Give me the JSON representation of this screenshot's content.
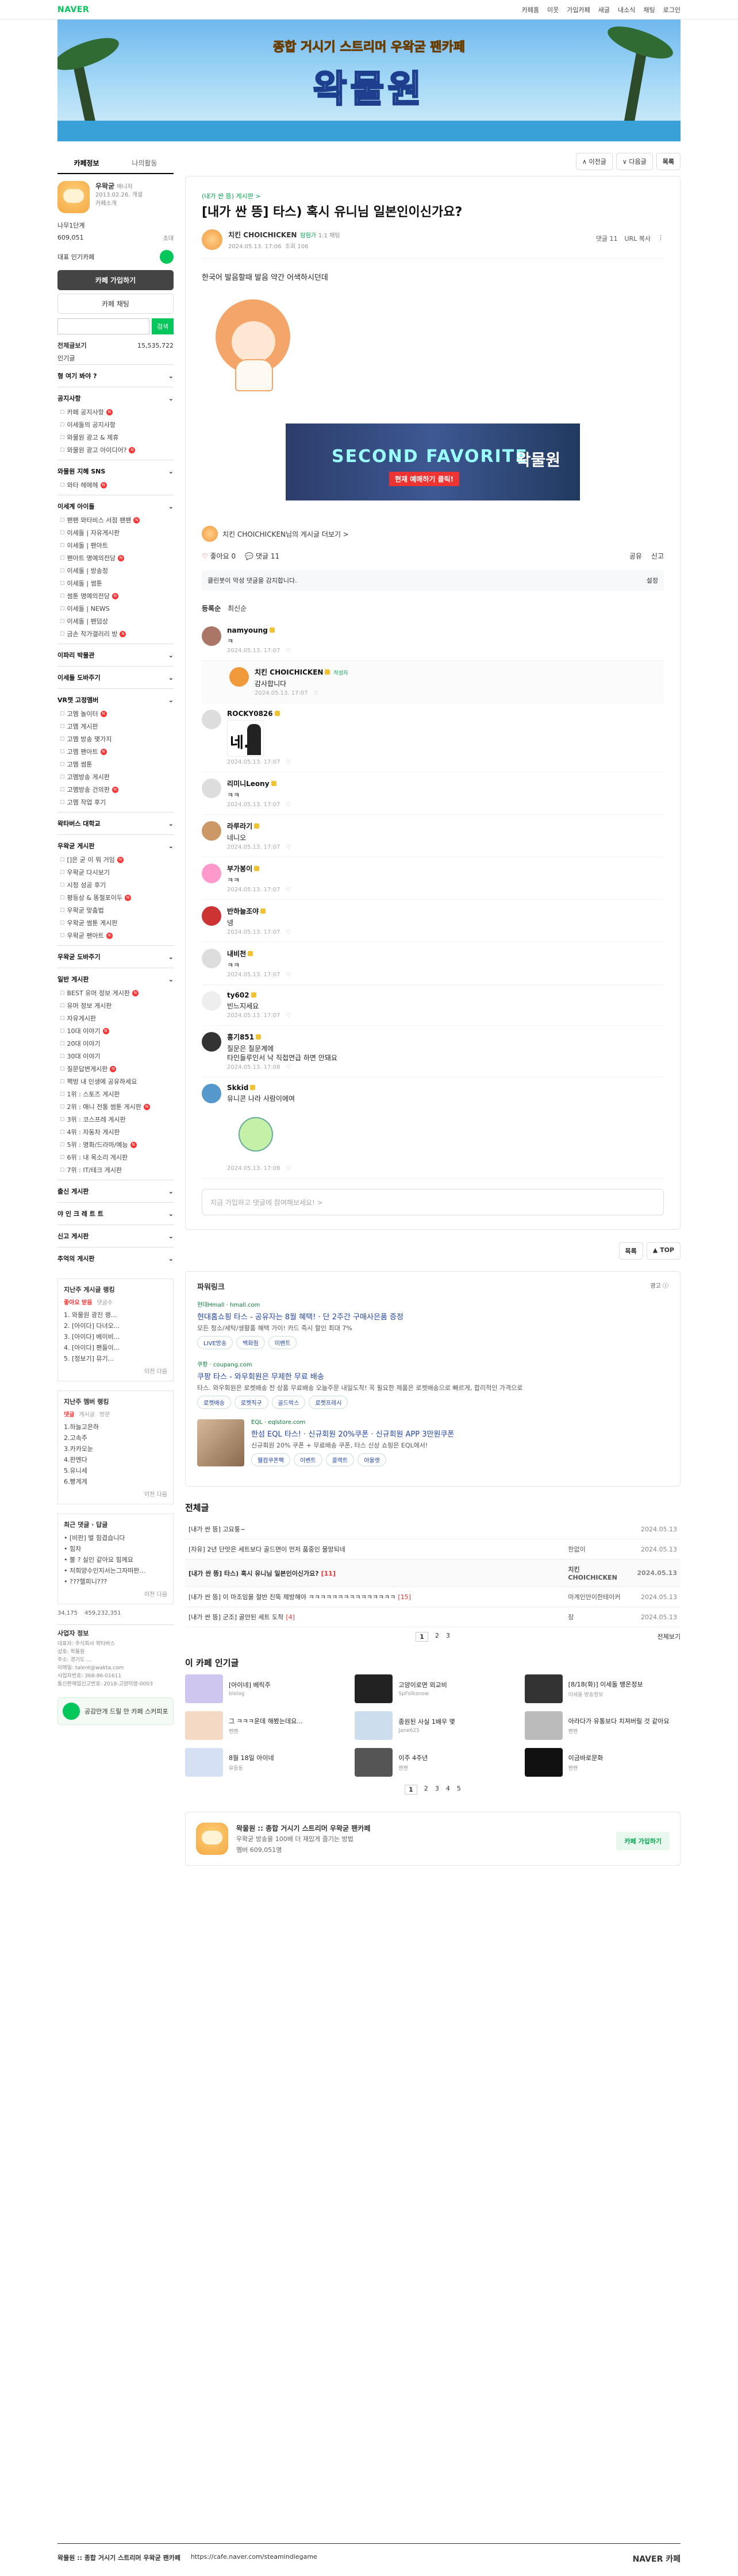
{
  "gnb": {
    "logo": "NAVER",
    "links": [
      "카페홈",
      "이웃",
      "가입카페",
      "새글",
      "내소식",
      "채팅",
      "로그인"
    ]
  },
  "banner": {
    "sub": "종합 거시기 스트리머 우왁굳 팬카페",
    "title": "왁물원"
  },
  "sidebar": {
    "tabs": [
      "카페정보",
      "나의활동"
    ],
    "manager": "우왁굳",
    "manager_role": "매니저",
    "since": "2013.02.26. 개설",
    "since_link": "카페소개",
    "level_name": "나무1단계",
    "members": "609,051",
    "members_link": "초대",
    "represent": "대표 인기카페",
    "join_btn": "카페 가입하기",
    "chat_btn": "카페 채팅",
    "search_btn": "검색",
    "all_posts": "전체글보기",
    "all_posts_count": "15,535,722",
    "popular": "인기글",
    "menus": [
      {
        "head": "형 여기 봐야 ?",
        "items": []
      },
      {
        "head": "공지사항",
        "items": [
          "카페 공지사항",
          "이세돌의 공지사항",
          "와물원 광고 & 제휴",
          "와물원 광고 아이디어?"
        ]
      },
      {
        "head": "와물원 지혜 SNS",
        "items": [
          "와타 헤에헤"
        ]
      },
      {
        "head": "이세계 아이돌",
        "items": [
          "팬팬 와타비스 서점 팬팬",
          "이세돌 | 자유게시판",
          "이세돌 | 팬아트",
          "팬아트 명예의전당",
          "이세돌 | 방송정",
          "이세돌 | 썸툰",
          "썸툰 명예의전당",
          "이세돌 | NEWS",
          "이세돌 | 팬덤상",
          "금손 작가갤러리 방"
        ]
      },
      {
        "head": "이파리 박물관",
        "items": []
      },
      {
        "head": "이세돌 도바주기",
        "items": []
      },
      {
        "head": "VR챗 고정멤버",
        "items": [
          "고멤 놀이터",
          "고멤 게시판",
          "고멤 방송 몇가지",
          "고멤 팬아트",
          "고멤 썸툰",
          "고멤방송 게시판",
          "고멤방송 건의판",
          "고멤 작업 후기"
        ]
      },
      {
        "head": "왁타버스 대학교",
        "items": []
      },
      {
        "head": "우왁굳 게시판",
        "items": [
          "[]은 굳 이 뭐 거임",
          "우왁굳 다시보기",
          "시청 성공 후기",
          "평등상 & 똥철포이두",
          "우왁굳 맞춤법",
          "우왁굳 썸툰 게시판",
          "우왁굳 팬아트"
        ]
      },
      {
        "head": "우왁굳 도바주기",
        "items": []
      },
      {
        "head": "일반 게시판",
        "items": [
          "BEST 유머 정보 게시판",
          "유머 정보 게시판",
          "자유게시판",
          "10대 이야기",
          "20대 이야기",
          "30대 이야기",
          "질문답변게시판",
          "팩방 내 인생에 공유하세요",
          "1위 : 스토즈 게시판",
          "2위 : 애니 전통 썸툰 게시판",
          "3위 : 코스프레 게시판",
          "4위 : 자동차 게시판",
          "5위 : 명화/드라마/예능",
          "6위 : 내 목소리 게시판",
          "7위 : IT/테크 게시판"
        ]
      },
      {
        "head": "출신 게시판",
        "items": []
      },
      {
        "head": "야 인 크 레 트 트",
        "items": []
      },
      {
        "head": "신고 게시판",
        "items": []
      },
      {
        "head": "추억의 게시판",
        "items": []
      }
    ],
    "rank1": {
      "title": "지난주 게시글 랭킹",
      "tabs": [
        "좋아요 받음",
        "댓글수"
      ],
      "items": [
        "1. 와물원 광진 랭...",
        "2. [아이다] 다녀오...",
        "3. [아이다] 베이비...",
        "4. [아이다] 팬들이...",
        "5. [정보기] 뮤기..."
      ],
      "pager": "이전 다음"
    },
    "rank2": {
      "title": "지난주 멤버 랭킹",
      "tabs": [
        "댓글",
        "게시글",
        "방문"
      ],
      "items": [
        "1.하늘고은하",
        "2.고속주",
        "3.카카오눈",
        "4.판멘다",
        "5.유니세",
        "6.빵게게"
      ],
      "pager": "이전 다음"
    },
    "rank3": {
      "title": "최근 댓글 · 답글",
      "items": [
        "• [비판] 벌 힘겹습니다",
        "• 힘차",
        "• 불 ? 실인 같아요 힘께요",
        "• 저희양수인지서는그자떠판...",
        "• ???헬피니???"
      ],
      "pager": "이전 다음"
    },
    "stats": [
      "34,175",
      "459,232,351"
    ],
    "biz": {
      "title": "사업자 정보",
      "lines": [
        "대표자: 주식회사 왁타버스",
        "상호: 왁물원",
        "주소: 경기도 ...",
        "이메일: talent@wakta.com",
        "사업자번호: 368-86-01611",
        "통신판매업신고번호: 2018-고양덕양-0003"
      ]
    },
    "green": "공감만개 드릴 만 카페 스커피포"
  },
  "topbar": {
    "prev": "∧ 이전글",
    "next": "∨ 다음글",
    "list": "목록"
  },
  "article": {
    "category": "(내가 싼 뜽) 게시판 >",
    "title": "[내가 싼 뜽] 타스) 혹시 유니님 일본인이신가요?",
    "author": "치킨 CHOICHICKEN",
    "author_role": "탐험가",
    "chat": "1:1 채팅",
    "date": "2024.05.13. 17:06",
    "views": "조회 106",
    "comments_label": "댓글 11",
    "url_copy": "URL 복사",
    "body": "한국어 발음할때 발음 약간 어색하시던데",
    "ad": {
      "left": "SECOND FAVORITE",
      "mid": "현재 예매하기 클릭!",
      "right": "왁물원"
    },
    "writer_link": "치킨 CHOICHICKEN님의 게시글 더보기 >",
    "likes": "좋아요 0",
    "comments": "댓글 11",
    "share": "공유",
    "report": "신고",
    "clean": "클린봇이 악성 댓글을 감지합니다.",
    "clean_setting": "설정",
    "ctabs": [
      "등록순",
      "최신순"
    ],
    "comment_items": [
      {
        "name": "namyoung",
        "text": "ㅋ",
        "date": "2024.05.13. 17:07",
        "reply": false,
        "color": "#a76"
      },
      {
        "name": "치킨 CHOICHICKEN",
        "text": "감사합니다",
        "date": "2024.05.13. 17:07",
        "reply": true,
        "color": "#f09a3c",
        "tag": "작성자"
      },
      {
        "name": "ROCKY0826",
        "text": "",
        "date": "2024.05.13. 17:07",
        "reply": false,
        "color": "#ddd",
        "img": "ne"
      },
      {
        "name": "리미니Leony",
        "text": "ㅋㅋ",
        "date": "2024.05.13. 17:07",
        "reply": false,
        "color": "#ddd"
      },
      {
        "name": "라루라기",
        "text": "네니오",
        "date": "2024.05.13. 17:07",
        "reply": false,
        "color": "#c96"
      },
      {
        "name": "부가봉이",
        "text": "ㅋㅋ",
        "date": "2024.05.13. 17:07",
        "reply": false,
        "color": "#f9c"
      },
      {
        "name": "반하늘조야",
        "text": "넹",
        "date": "2024.05.13. 17:07",
        "reply": false,
        "color": "#c33"
      },
      {
        "name": "내비천",
        "text": "ㅋㅋ",
        "date": "2024.05.13. 17:07",
        "reply": false,
        "color": "#ddd"
      },
      {
        "name": "ty602",
        "text": "빈느지세요",
        "date": "2024.05.13. 17:07",
        "reply": false,
        "color": "#eee"
      },
      {
        "name": "흥기851",
        "text": "질문은 질문계에\n타인들루인서 낙 직접연급 하면 안돼요",
        "date": "2024.05.13. 17:08",
        "reply": false,
        "color": "#333"
      },
      {
        "name": "Skkid",
        "text": "유니콘 나라 사람이에여",
        "date": "2024.05.13. 17:08",
        "reply": false,
        "color": "#59c",
        "img": "dino"
      }
    ],
    "comment_placeholder": "지금 가입하고 댓글에 참여해보세요! >"
  },
  "botbar": {
    "list": "목록",
    "top": "▲ TOP"
  },
  "powerlink": {
    "title": "파워링크",
    "ad": "광고 ⓘ",
    "ads": [
      {
        "src": "현대Hmall · hmall.com",
        "title": "현대홈쇼핑 타스 - 공유자는 8월 혜택! · 단 2주간 구매사은품 증정",
        "desc": "모든 청소/세탁/생활품 혜택 가이! 카드 즉시 할인 최대 7%",
        "chips": [
          "LIVE방송",
          "백화점",
          "이벤트"
        ]
      },
      {
        "src": "쿠팡 · coupang.com",
        "title": "쿠팡 타스 - 와우회원은 무제한 무료 배송",
        "desc": "타스. 와우회원은 로켓배송 전 상품 무료배송 오늘주문 내일도착! 꼭 필요한 제품은 로켓배송으로 빠르게, 합리적인 가격으로",
        "chips": [
          "로켓배송",
          "로켓직구",
          "골드박스",
          "로켓프레시"
        ]
      },
      {
        "src": "EQL · eqlstore.com",
        "title": "한섬 EQL 타스! · 신규회원 20%쿠폰 · 신규회원 APP 3만원쿠폰",
        "desc": "신규회원 20% 쿠폰 + 무료배송 쿠폰, 타스 신상 쇼핑은 EQL에서!",
        "chips": [
          "웰컴쿠폰팩",
          "이벤트",
          "콜렉트",
          "아울렛"
        ]
      }
    ]
  },
  "allposts": {
    "title": "전체글",
    "rows": [
      {
        "t": "[내가 싼 뜽] 고요퉁~",
        "c": "",
        "a": "",
        "d": "2024.05.13"
      },
      {
        "t": "[자유] 2년 단맛은 세트보다 골드면이 먼저 품중인 물망되네",
        "c": "",
        "a": "한없이",
        "d": "2024.05.13"
      },
      {
        "t": "[내가 싼 뜽] 타스) 혹시 유니님 일본인이신가요?",
        "c": "[11]",
        "a": "치킨 CHOICHICKEN",
        "d": "2024.05.13",
        "cur": true
      },
      {
        "t": "[내가 싼 뜽] 이 마조임을 절반 진뚝 제방해야 ㅋㅋㅋㅋㅋㅋㅋㅋㅋㅋㅋㅋㅋㅋㅋ",
        "c": "[15]",
        "a": "마계인안이한테이커",
        "d": "2024.05.13"
      },
      {
        "t": "[내가 싼 뜽] 군조] 골안된 세트 도착",
        "c": "[4]",
        "a": "잠",
        "d": "2024.05.13"
      }
    ],
    "pages": [
      "1",
      "2",
      "3"
    ],
    "all": "전체보기"
  },
  "popular": {
    "title": "이 카페 인기글",
    "items": [
      {
        "t": "[아이네] 베릭주",
        "s": "blelog",
        "c": "#cfc6f0"
      },
      {
        "t": "고양이로면 외교비",
        "s": "SpFolksnow",
        "c": "#222"
      },
      {
        "t": "[8/18(화)] 이세돌 뱅온정보",
        "s": "이세돌 방송정보",
        "c": "#333"
      },
      {
        "t": "그 ㅋㅋㅋ운데 해봤는데요...",
        "s": "팬팬",
        "c": "#f4d9c5"
      },
      {
        "t": "종원된 사실 1배우 몇",
        "s": "Jane625",
        "c": "#cde"
      },
      {
        "t": "아라다가 유통보다 치져버릴 것 같아요",
        "s": "팬팬",
        "c": "#bbb"
      },
      {
        "t": "8월 18일 아이네",
        "s": "유동동",
        "c": "#d6e0f5"
      },
      {
        "t": "이주 4주년",
        "s": "팬팬",
        "c": "#555"
      },
      {
        "t": "이금바로문화",
        "s": "팬팬",
        "c": "#111"
      }
    ],
    "pages": [
      "1",
      "2",
      "3",
      "4",
      "5"
    ]
  },
  "cafecard": {
    "name": "왁물원 :: 종합 거시기 스트리머 우왁굳 팬카페",
    "desc": "우왁굳 방송을 100배 더 재밌게 즐기는 방법",
    "members": "멤버 609,051명",
    "join": "카페 가입하기"
  },
  "footer": {
    "left": "왁물원 :: 종합 거시기 스트리머 우왁굳 팬카페",
    "url": "https://cafe.naver.com/steamindiegame",
    "right": "NAVER 카페"
  }
}
